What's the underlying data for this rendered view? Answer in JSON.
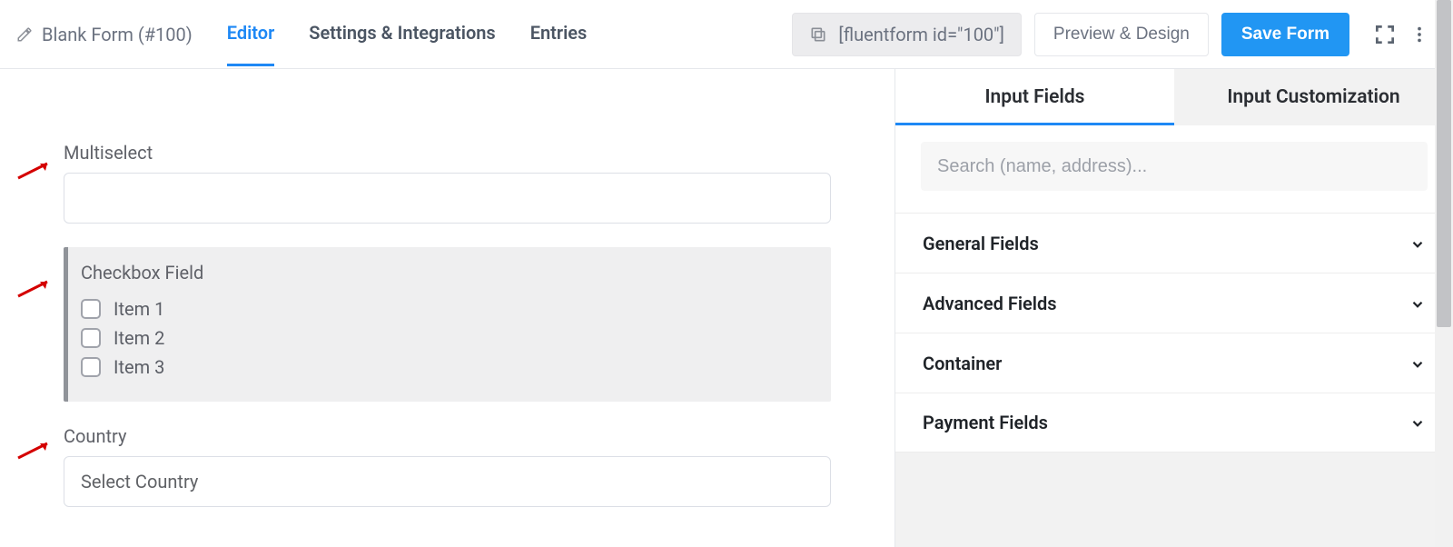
{
  "header": {
    "title": "Blank Form (#100)",
    "tabs": [
      "Editor",
      "Settings & Integrations",
      "Entries"
    ],
    "active_tab_index": 0,
    "shortcode_text": "[fluentform id=\"100\"]",
    "preview_label": "Preview & Design",
    "save_label": "Save Form"
  },
  "canvas": {
    "multiselect_label": "Multiselect",
    "checkbox_label": "Checkbox Field",
    "checkbox_items": [
      "Item 1",
      "Item 2",
      "Item 3"
    ],
    "country_label": "Country",
    "country_placeholder": "Select Country"
  },
  "panel": {
    "tabs": [
      "Input Fields",
      "Input Customization"
    ],
    "active_tab_index": 0,
    "search_placeholder": "Search (name, address)...",
    "groups": [
      "General Fields",
      "Advanced Fields",
      "Container",
      "Payment Fields"
    ]
  }
}
